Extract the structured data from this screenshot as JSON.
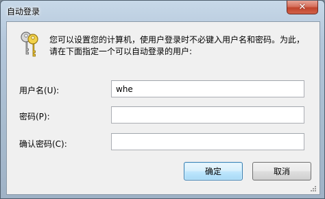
{
  "window": {
    "title": "自动登录"
  },
  "titlebar": {
    "close_glyph": "✕"
  },
  "icons": {
    "keys": "keys-icon",
    "close": "close-icon"
  },
  "description": {
    "line1": "您可以设置您的计算机，使用户登录时不必键入用户名和密码。为此，",
    "line2": "请在下面指定一个可以自动登录的用户:"
  },
  "form": {
    "username": {
      "label": "用户名(U):",
      "value": "whe"
    },
    "password": {
      "label": "密码(P):",
      "value": ""
    },
    "confirm_password": {
      "label": "确认密码(C):",
      "value": ""
    }
  },
  "buttons": {
    "ok": "确定",
    "cancel": "取消"
  },
  "colors": {
    "ok_border": "#3c7fb1",
    "close_button": "#c0442c",
    "client_background": "#f0f0f0"
  }
}
